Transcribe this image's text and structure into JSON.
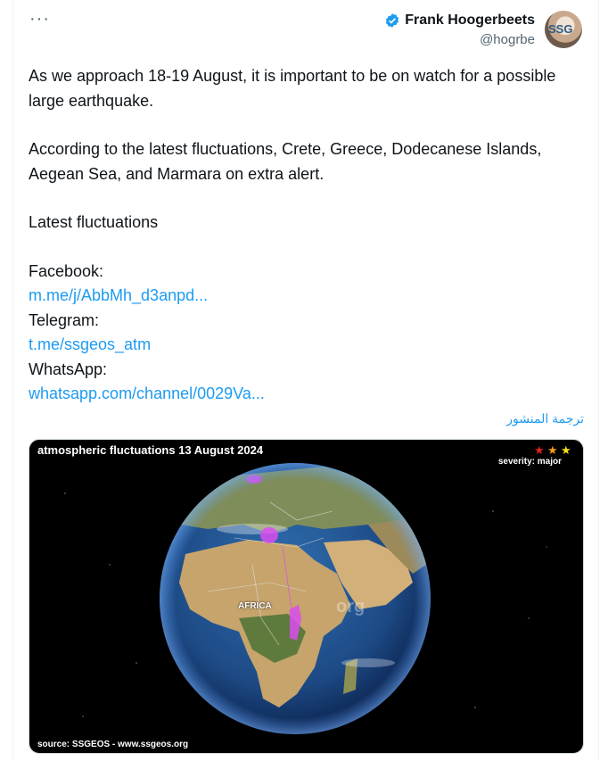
{
  "header": {
    "more_icon": "more-dots-icon",
    "author_name": "Frank Hoogerbeets",
    "author_handle": "@hogrbe",
    "verified_icon": "verified-badge-icon",
    "avatar_text": "SSG"
  },
  "tweet": {
    "line1": "As we approach 18-19 August, it is important to be on watch for a possible large earthquake.",
    "line2": "According to the latest fluctuations, Crete, Greece, Dodecanese Islands, Aegean Sea, and Marmara on extra alert.",
    "line3": "Latest fluctuations",
    "facebook_label": "Facebook:",
    "facebook_link": "m.me/j/AbbMh_d3anpd...",
    "telegram_label": "Telegram:",
    "telegram_link": "t.me/ssgeos_atm",
    "whatsapp_label": "WhatsApp:",
    "whatsapp_link": "whatsapp.com/channel/0029Va..."
  },
  "translate_label": "ترجمة المنشور",
  "media": {
    "title": "atmospheric fluctuations 13 August 2024",
    "severity": "severity: major",
    "source": "source: SSGEOS - www.ssgeos.org",
    "map_label": "AFRICA",
    "watermark": "org",
    "star_colors": [
      "#e4201a",
      "#f39c12",
      "#f7e017"
    ]
  }
}
